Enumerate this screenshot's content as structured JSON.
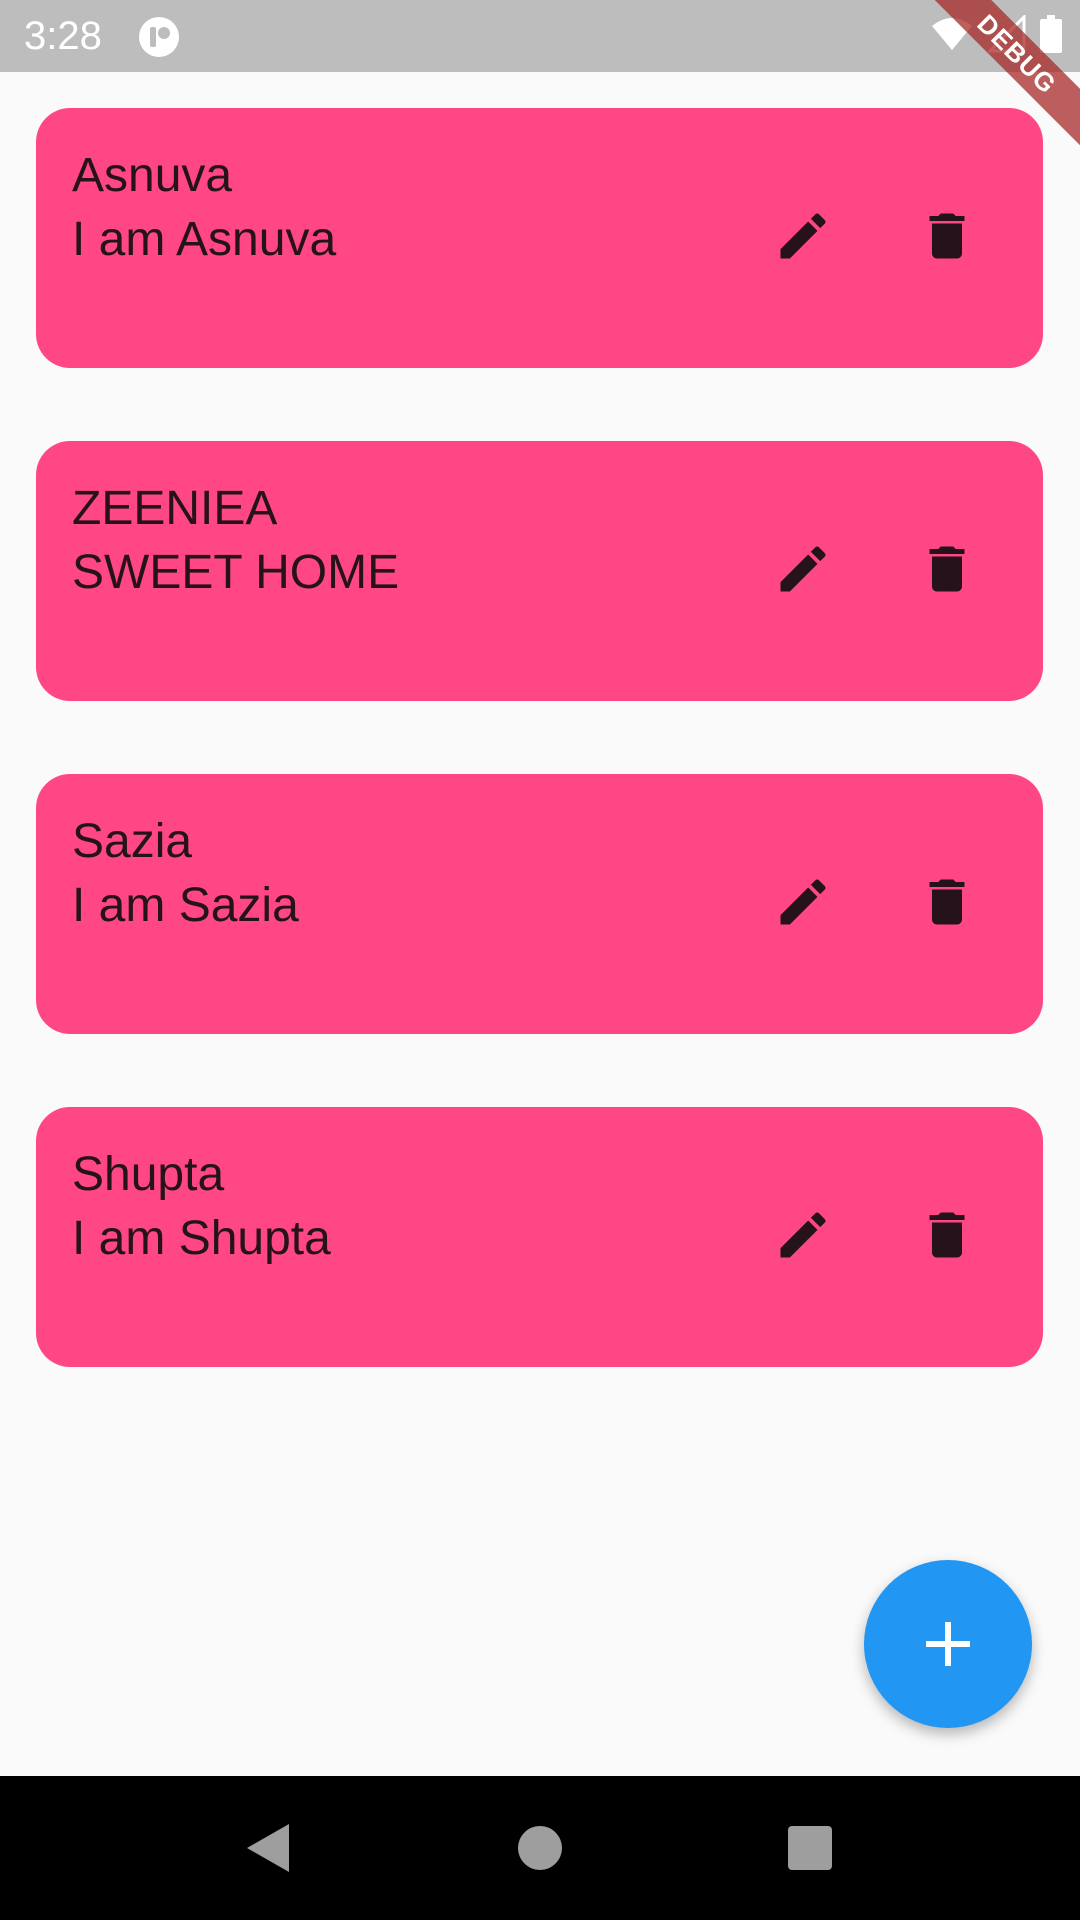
{
  "status_bar": {
    "time": "3:28",
    "icons": [
      "app-indicator-icon",
      "wifi-icon",
      "cellular-signal-icon",
      "battery-icon"
    ]
  },
  "debug_banner": {
    "label": "DEBUG",
    "color": "#a82a2a"
  },
  "notes": [
    {
      "title": "Asnuva",
      "body": "I am Asnuva"
    },
    {
      "title": "ZEENIEA",
      "body": "SWEET HOME"
    },
    {
      "title": "Sazia",
      "body": "I am Sazia"
    },
    {
      "title": "Shupta",
      "body": "I am Shupta"
    }
  ],
  "note_actions": [
    "edit-icon",
    "delete-icon"
  ],
  "fab": {
    "icon": "add-icon"
  },
  "nav_bar": {
    "icons": [
      "back-icon",
      "home-icon",
      "recents-icon"
    ]
  },
  "colors": {
    "card": "#ff4785",
    "card_text": "#26121b",
    "fab": "#2196f3",
    "status_bar": "#bdbdbd",
    "background": "#fafafa"
  }
}
